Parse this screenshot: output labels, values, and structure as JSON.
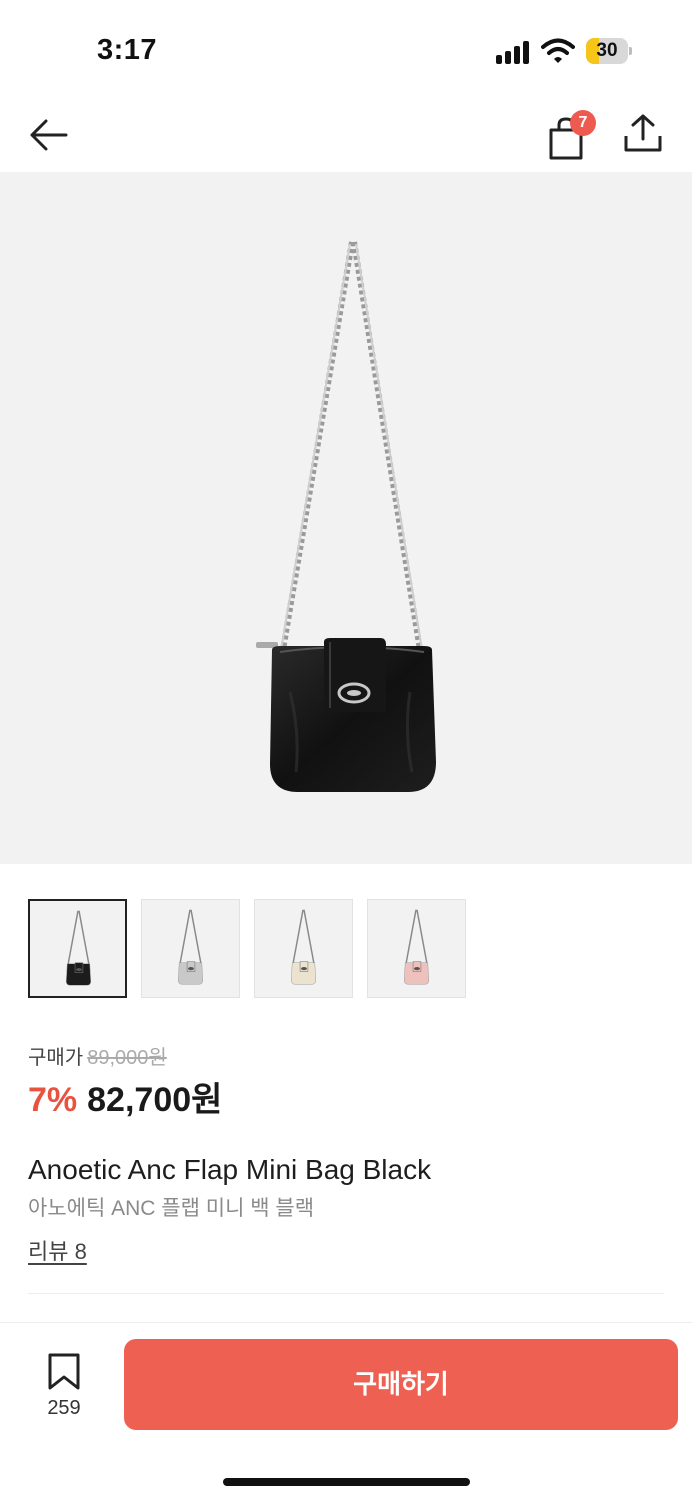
{
  "status": {
    "time": "3:17",
    "battery": "30",
    "battery_level_percent": 30
  },
  "nav": {
    "cart_count": "7"
  },
  "product": {
    "price_label": "구매가",
    "original_price": "89,000원",
    "discount": "7%",
    "sale_price": "82,700원",
    "name_en": "Anoetic Anc Flap Mini Bag Black",
    "name_ko": "아노에틱 ANC 플랩 미니 백 블랙",
    "review_label": "리뷰 8"
  },
  "thumbnails": [
    {
      "color": "#1c1c1c",
      "selected": true
    },
    {
      "color": "#c9c9c9",
      "selected": false
    },
    {
      "color": "#ebe3cf",
      "selected": false
    },
    {
      "color": "#eec1bc",
      "selected": false
    }
  ],
  "bottom": {
    "bookmark_count": "259",
    "buy_label": "구매하기"
  },
  "colors": {
    "accent": "#ee6152",
    "discount": "#e8533f",
    "badge": "#ee5a4f",
    "image_bg": "#f2f2f2"
  }
}
